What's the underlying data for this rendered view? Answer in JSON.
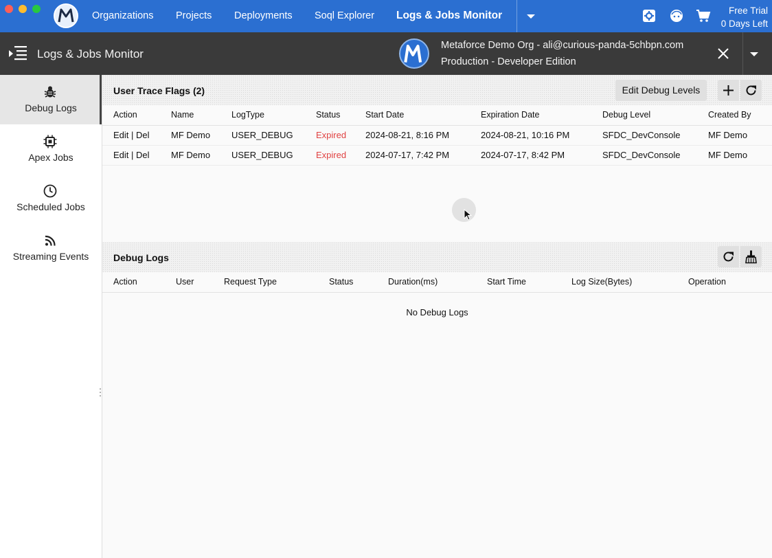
{
  "window": {
    "nav": {
      "items": [
        "Organizations",
        "Projects",
        "Deployments",
        "Soql Explorer"
      ],
      "active": "Logs & Jobs Monitor",
      "trial_line1": "Free Trial",
      "trial_line2": "0 Days Left"
    },
    "header": {
      "title": "Logs & Jobs Monitor",
      "org_name": "Metaforce Demo Org - ali@curious-panda-5chbpn.com",
      "org_type": "Production - Developer Edition"
    }
  },
  "sidebar": {
    "items": [
      {
        "label": "Debug Logs",
        "icon": "bug-icon",
        "active": true
      },
      {
        "label": "Apex Jobs",
        "icon": "chip-icon",
        "active": false
      },
      {
        "label": "Scheduled Jobs",
        "icon": "clock-icon",
        "active": false
      },
      {
        "label": "Streaming Events",
        "icon": "rss-icon",
        "active": false
      }
    ]
  },
  "trace_flags": {
    "title": "User Trace Flags (2)",
    "edit_levels_label": "Edit Debug Levels",
    "columns": [
      "Action",
      "Name",
      "LogType",
      "Status",
      "Start Date",
      "Expiration Date",
      "Debug Level",
      "Created By"
    ],
    "rows": [
      {
        "action": "Edit | Del",
        "name": "MF Demo",
        "log_type": "USER_DEBUG",
        "status": "Expired",
        "start": "2024-08-21, 8:16 PM",
        "expiration": "2024-08-21, 10:16 PM",
        "level": "SFDC_DevConsole",
        "created_by": "MF Demo"
      },
      {
        "action": "Edit | Del",
        "name": "MF Demo",
        "log_type": "USER_DEBUG",
        "status": "Expired",
        "start": "2024-07-17, 7:42 PM",
        "expiration": "2024-07-17, 8:42 PM",
        "level": "SFDC_DevConsole",
        "created_by": "MF Demo"
      }
    ]
  },
  "debug_logs": {
    "title": "Debug Logs",
    "columns": [
      "Action",
      "User",
      "Request Type",
      "Status",
      "Duration(ms)",
      "Start Time",
      "Log Size(Bytes)",
      "Operation"
    ],
    "empty_message": "No Debug Logs"
  },
  "colors": {
    "nav_bg": "#2b6fd1",
    "header_bg": "#3a3a3a",
    "expired": "#e04242"
  }
}
